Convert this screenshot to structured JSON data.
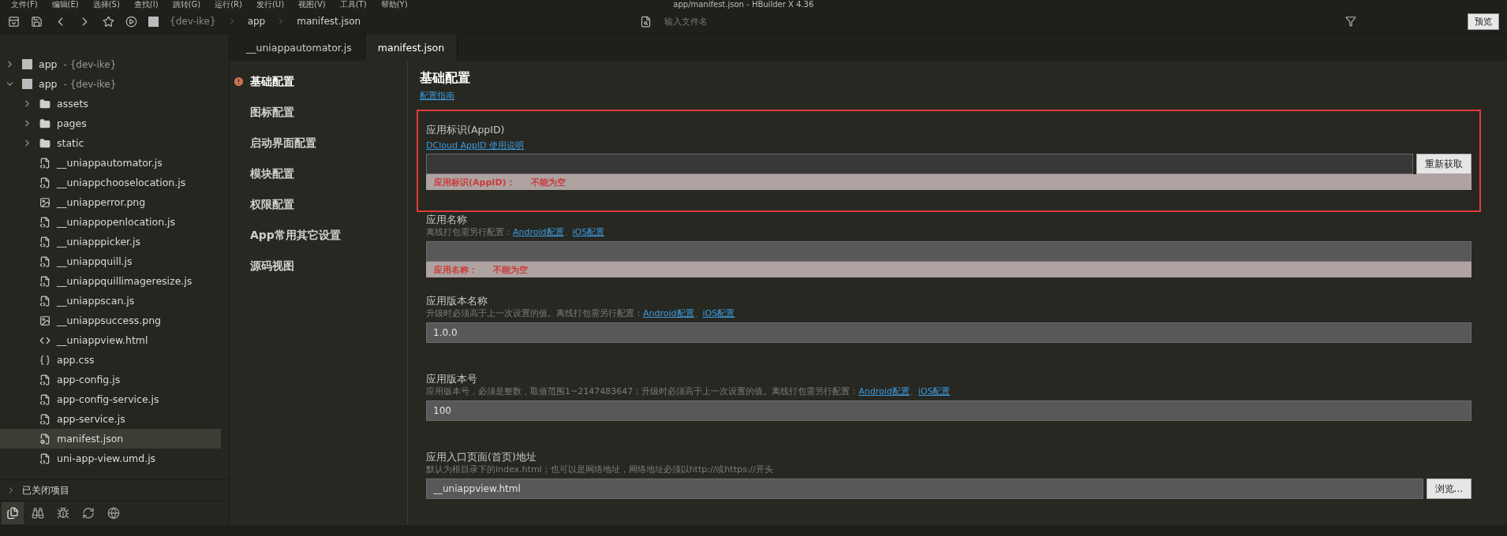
{
  "menu": [
    "文件(F)",
    "编辑(E)",
    "选择(S)",
    "查找(I)",
    "跳转(G)",
    "运行(R)",
    "发行(U)",
    "视图(V)",
    "工具(T)",
    "帮助(Y)"
  ],
  "window_title": "app/manifest.json - HBuilder X 4.36",
  "breadcrumb": [
    "{dev-ike}",
    "app",
    "manifest.json"
  ],
  "file_search": {
    "placeholder": "输入文件名"
  },
  "preview_button": "预览",
  "projects": [
    {
      "name": "app",
      "branch": "- {dev-ike}",
      "expanded": false
    },
    {
      "name": "app",
      "branch": "- {dev-ike}",
      "expanded": true,
      "children": [
        {
          "name": "assets",
          "kind": "folder",
          "expanded": false,
          "selected": false
        },
        {
          "name": "pages",
          "kind": "folder",
          "expanded": false,
          "selected": false
        },
        {
          "name": "static",
          "kind": "folder",
          "expanded": false,
          "selected": false
        },
        {
          "name": "__uniappautomator.js",
          "kind": "js",
          "selected": false
        },
        {
          "name": "__uniappchooselocation.js",
          "kind": "js",
          "selected": false
        },
        {
          "name": "__uniapperror.png",
          "kind": "image",
          "selected": false
        },
        {
          "name": "__uniappopenlocation.js",
          "kind": "js",
          "selected": false
        },
        {
          "name": "__uniapppicker.js",
          "kind": "js",
          "selected": false
        },
        {
          "name": "__uniappquill.js",
          "kind": "js",
          "selected": false
        },
        {
          "name": "__uniappquillimageresize.js",
          "kind": "js",
          "selected": false
        },
        {
          "name": "__uniappscan.js",
          "kind": "js",
          "selected": false
        },
        {
          "name": "__uniappsuccess.png",
          "kind": "image",
          "selected": false
        },
        {
          "name": "__uniappview.html",
          "kind": "html",
          "selected": false
        },
        {
          "name": "app.css",
          "kind": "css",
          "selected": false
        },
        {
          "name": "app-config.js",
          "kind": "js",
          "selected": false
        },
        {
          "name": "app-config-service.js",
          "kind": "js",
          "selected": false
        },
        {
          "name": "app-service.js",
          "kind": "js",
          "selected": false
        },
        {
          "name": "manifest.json",
          "kind": "json",
          "selected": true
        },
        {
          "name": "uni-app-view.umd.js",
          "kind": "js",
          "selected": false
        }
      ]
    }
  ],
  "closed_projects": "已关闭项目",
  "activity_bar": [
    {
      "kind": "files",
      "selected": true
    },
    {
      "kind": "binoculars",
      "selected": false
    },
    {
      "kind": "bug",
      "selected": false
    },
    {
      "kind": "refresh",
      "selected": false
    },
    {
      "kind": "globe",
      "selected": false
    }
  ],
  "editor_tabs": [
    {
      "label": "__uniappautomator.js",
      "selected": false
    },
    {
      "label": "manifest.json",
      "selected": true
    }
  ],
  "nav": [
    {
      "label": "基础配置",
      "selected": true,
      "warning": true
    },
    {
      "label": "图标配置",
      "selected": false,
      "warning": false
    },
    {
      "label": "启动界面配置",
      "selected": false,
      "warning": false
    },
    {
      "label": "模块配置",
      "selected": false,
      "warning": false
    },
    {
      "label": "权限配置",
      "selected": false,
      "warning": false
    },
    {
      "label": "App常用其它设置",
      "selected": false,
      "warning": false
    },
    {
      "label": "源码视图",
      "selected": false,
      "warning": false
    }
  ],
  "form": {
    "title": "基础配置",
    "guide_link": "配置指南",
    "fields": [
      {
        "label": "应用标识(AppID)",
        "highlighted": true,
        "focused": true,
        "help_link": "DCloud AppID 使用说明",
        "button": "重新获取",
        "error": {
          "label": "应用标识(AppID)：",
          "message": "不能为空"
        }
      },
      {
        "label": "应用名称",
        "focused": false,
        "hint": [
          {
            "kind": "text",
            "text": "离线打包需另行配置："
          },
          {
            "kind": "link",
            "text": "Android配置"
          },
          {
            "kind": "text",
            "text": "、"
          },
          {
            "kind": "link",
            "text": "iOS配置"
          }
        ],
        "error": {
          "label": "应用名称：",
          "message": "不能为空"
        }
      },
      {
        "label": "应用版本名称",
        "focused": false,
        "hint": [
          {
            "kind": "text",
            "text": "升级时必须高于上一次设置的值。离线打包需另行配置："
          },
          {
            "kind": "link",
            "text": "Android配置"
          },
          {
            "kind": "text",
            "text": "、"
          },
          {
            "kind": "link",
            "text": "iOS配置"
          }
        ],
        "value": "1.0.0"
      },
      {
        "label": "应用版本号",
        "focused": false,
        "hint": [
          {
            "kind": "text",
            "text": "应用版本号，必须是整数，取值范围1~2147483647；升级时必须高于上一次设置的值。离线打包需另行配置："
          },
          {
            "kind": "link",
            "text": "Android配置"
          },
          {
            "kind": "text",
            "text": "、"
          },
          {
            "kind": "link",
            "text": "iOS配置"
          }
        ],
        "value": "100"
      },
      {
        "label": "应用入口页面(首页)地址",
        "focused": false,
        "hint": [
          {
            "kind": "text",
            "text": "默认为根目录下的index.html；也可以是网络地址，网络地址必须以http://或https://开头"
          }
        ],
        "value": "__uniappview.html",
        "button": "浏览..."
      }
    ]
  }
}
